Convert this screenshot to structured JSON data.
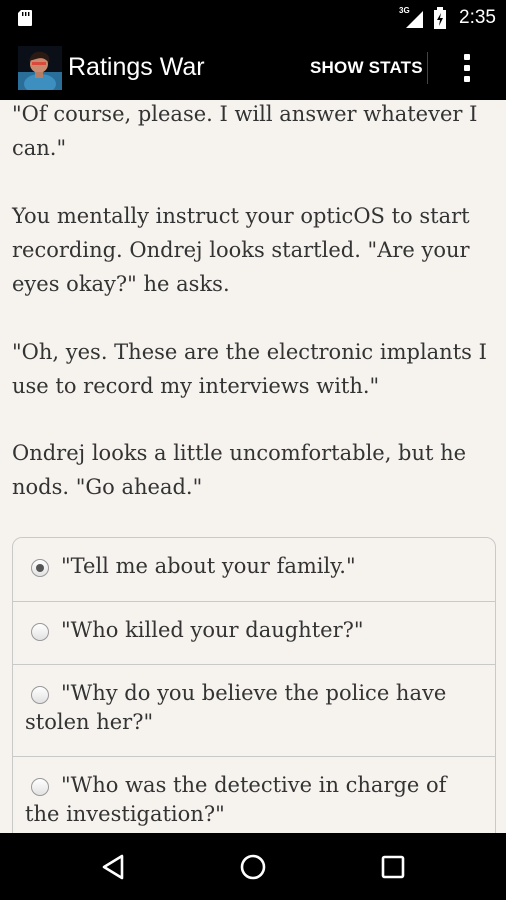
{
  "status_bar": {
    "network": "3G",
    "time": "2:35"
  },
  "app_bar": {
    "title": "Ratings War",
    "show_stats_label": "SHOW STATS"
  },
  "story": {
    "paragraphs": [
      "\"Of course, please. I will answer whatever I can.\"",
      "You mentally instruct your opticOS to start recording. Ondrej looks startled. \"Are your eyes okay?\" he asks.",
      "\"Oh, yes. These are the electronic implants I use to record my interviews with.\"",
      "Ondrej looks a little uncomfortable, but he nods. \"Go ahead.\""
    ]
  },
  "choices": [
    {
      "label": "\"Tell me about your family.\"",
      "selected": true
    },
    {
      "label": "\"Who killed your daughter?\"",
      "selected": false
    },
    {
      "label": "\"Why do you believe the police have stolen her?\"",
      "selected": false
    },
    {
      "label": "\"Who was the detective in charge of the investigation?\"",
      "selected": false
    }
  ],
  "icons": {
    "sd_card": "sd-card-icon",
    "signal": "signal-icon",
    "battery": "battery-icon",
    "overflow": "overflow-menu-icon",
    "nav_back": "back-icon",
    "nav_home": "home-icon",
    "nav_recents": "recents-icon"
  }
}
